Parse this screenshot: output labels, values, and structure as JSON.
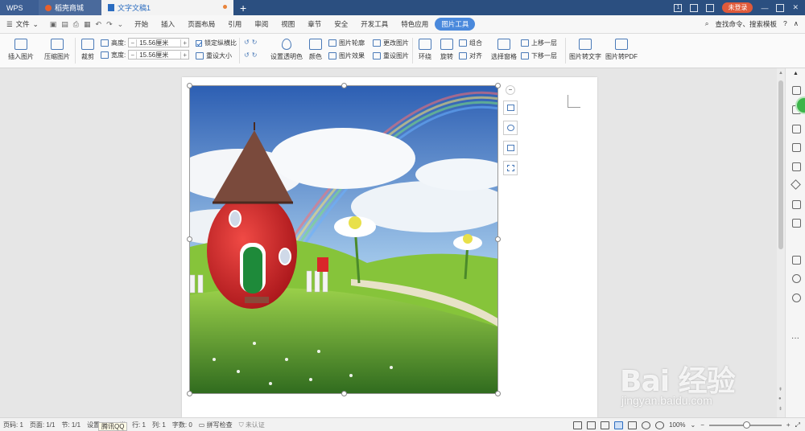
{
  "titlebar": {
    "tabs": [
      {
        "label": "WPS"
      },
      {
        "label": "稻壳商城"
      },
      {
        "label": "文字文稿1"
      }
    ],
    "page_indicator": "1",
    "login_label": "未登录"
  },
  "menubar": {
    "file_label": "文件",
    "items": [
      "开始",
      "插入",
      "页面布局",
      "引用",
      "审阅",
      "视图",
      "章节",
      "安全",
      "开发工具",
      "特色应用",
      "图片工具"
    ],
    "active_item": "图片工具",
    "search_label": "查找命令、搜索模板"
  },
  "ribbon": {
    "insert_picture": "插入图片",
    "compress_picture": "压缩图片",
    "crop": "裁剪",
    "height_label": "高度:",
    "height_value": "15.56厘米",
    "width_label": "宽度:",
    "width_value": "15.56厘米",
    "lock_ratio": "锁定纵横比",
    "reset_size": "重设大小",
    "set_transparent": "设置透明色",
    "color": "颜色",
    "picture_outline": "图片轮廓",
    "picture_effects": "图片效果",
    "change_picture": "更改图片",
    "reset_picture": "重设图片",
    "wrap": "环绕",
    "rotate": "旋转",
    "group": "组合",
    "align": "对齐",
    "selection_pane": "选择窗格",
    "bring_forward": "上移一层",
    "send_backward": "下移一层",
    "picture_to_text": "图片转文字",
    "picture_to_pdf": "图片转PDF"
  },
  "statusbar": {
    "page_num": "页码: 1",
    "pages": "页面: 1/1",
    "section": "节: 1/1",
    "setting": "设置",
    "qq_tip": "腾讯QQ",
    "unit_tail": "米",
    "row": "行: 1",
    "col": "列: 1",
    "word_count": "字数: 0",
    "spell_check": "拼写检查",
    "certification": "未认证",
    "zoom": "100%"
  },
  "watermark": {
    "brand": "Bai 经验",
    "url": "jingyan.baidu.com"
  }
}
